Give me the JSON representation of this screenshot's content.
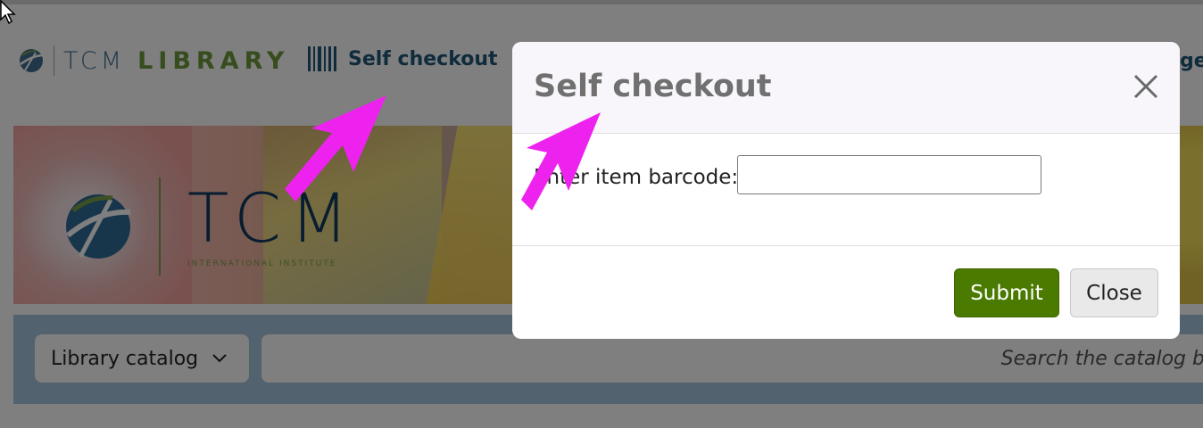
{
  "navbar": {
    "logo_tcm": "TCM",
    "logo_library": "LIBRARY",
    "self_checkout_label": "Self checkout",
    "right_partial": "ge"
  },
  "banner": {
    "title": "TCM",
    "subtitle": "INTERNATIONAL INSTITUTE"
  },
  "search": {
    "catalog_label": "Library catalog",
    "placeholder": "Search the catalog by"
  },
  "modal": {
    "title": "Self checkout",
    "barcode_label": "Enter item barcode:",
    "barcode_value": "",
    "submit_label": "Submit",
    "close_label": "Close"
  },
  "colors": {
    "brand_blue": "#1f5679",
    "brand_green": "#6e9a3a",
    "submit_green": "#4a7a00",
    "annotation_arrow": "#ee22ee"
  },
  "icons": [
    "tcm-globe-icon",
    "barcode-icon",
    "chevron-down-icon",
    "close-icon",
    "annotation-arrow",
    "mouse-cursor-icon"
  ]
}
